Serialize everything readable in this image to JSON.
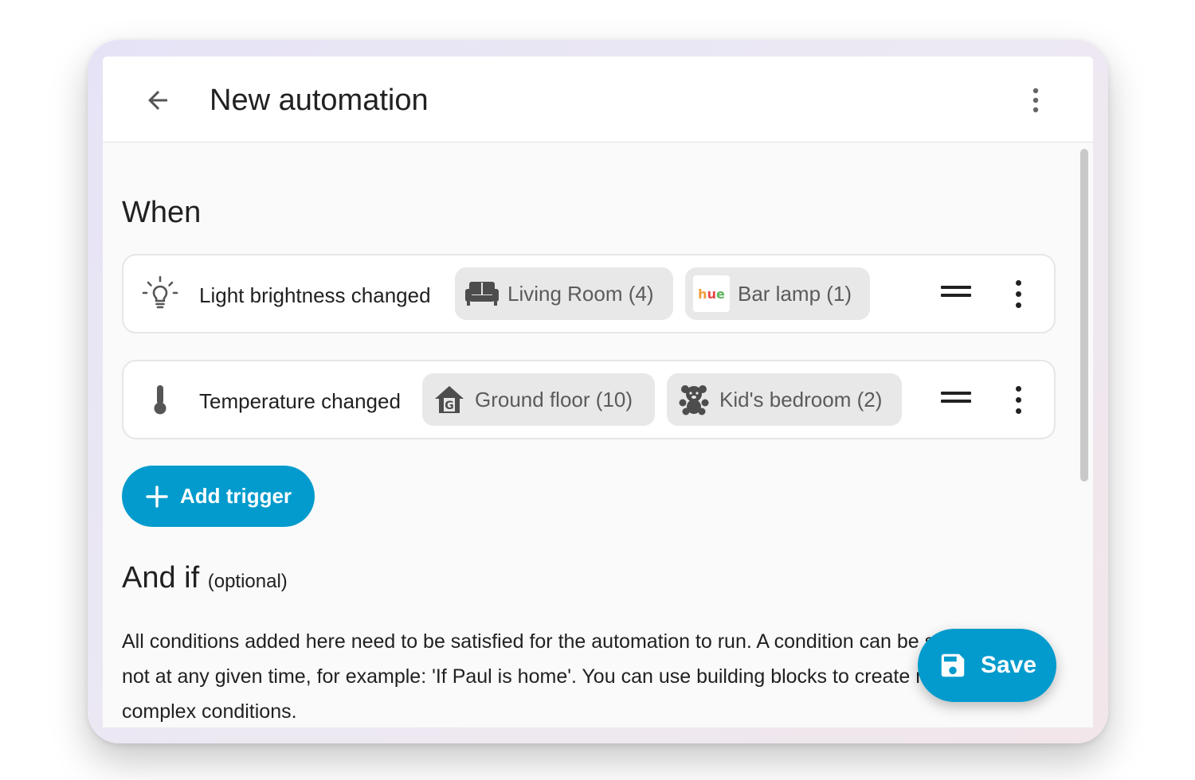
{
  "header": {
    "title": "New automation",
    "back_icon": "arrow-left-icon",
    "menu_icon": "dots-vertical-icon"
  },
  "when_section": {
    "title": "When",
    "triggers": [
      {
        "label": "Light brightness changed",
        "icon": "lightbulb-icon",
        "chips": [
          {
            "label": "Living Room (4)",
            "icon": "sofa-icon"
          },
          {
            "label": "Bar lamp (1)",
            "icon": "hue-logo",
            "logo_text": "hue"
          }
        ]
      },
      {
        "label": "Temperature changed",
        "icon": "thermometer-icon",
        "chips": [
          {
            "label": "Ground floor (10)",
            "icon": "home-floor-icon"
          },
          {
            "label": "Kid's bedroom (2)",
            "icon": "teddy-bear-icon"
          }
        ]
      }
    ],
    "add_trigger_label": "Add trigger"
  },
  "and_if_section": {
    "title": "And if",
    "optional_label": "(optional)",
    "description": "All conditions added here need to be satisfied for the automation to run. A condition can be satisfied or not at any given time, for example: 'If Paul is home'. You can use building blocks to create more complex conditions."
  },
  "save_fab": {
    "label": "Save",
    "icon": "floppy-disk-icon"
  },
  "colors": {
    "primary": "#039bcd",
    "chip_bg": "#e8e8e8",
    "background": "#fafafa"
  }
}
